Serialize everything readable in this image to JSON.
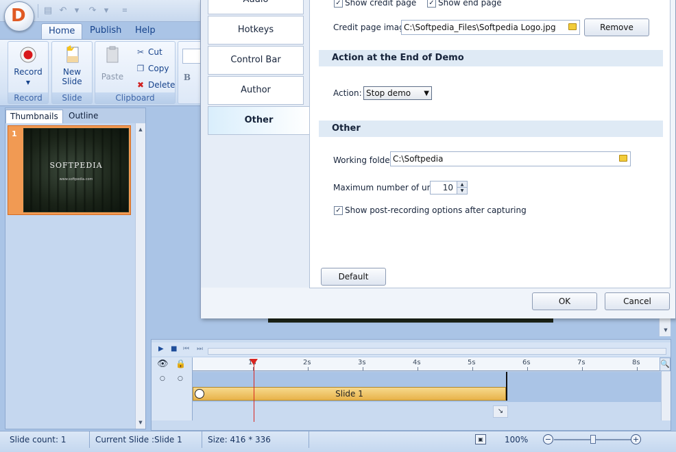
{
  "ribbon": {
    "tabs": [
      "Home",
      "Publish",
      "Help"
    ],
    "groups": {
      "record": {
        "label": "Record",
        "record_btn": "Record"
      },
      "slide": {
        "label": "Slide",
        "new_slide_line1": "New",
        "new_slide_line2": "Slide"
      },
      "clipboard": {
        "label": "Clipboard",
        "paste": "Paste",
        "cut": "Cut",
        "copy": "Copy",
        "delete": "Delete"
      }
    },
    "bold_glyph": "B"
  },
  "slides_pane": {
    "tabs": [
      "Thumbnails",
      "Outline"
    ],
    "thumbnail": {
      "number": "1",
      "logo_text": "SOFTPEDIA",
      "url_text": "www.softpedia.com"
    }
  },
  "dialog": {
    "nav": [
      "Audio",
      "Hotkeys",
      "Control Bar",
      "Author",
      "Other"
    ],
    "checkboxes": {
      "show_credit_page": {
        "label": "Show credit page",
        "checked": true
      },
      "show_end_page": {
        "label": "Show end page",
        "checked": true
      },
      "show_post_recording": {
        "label": "Show post-recording options after capturing",
        "checked": true
      }
    },
    "credit_page_image": {
      "label": "Credit page image:",
      "value": "C:\\Softpedia_Files\\Softpedia Logo.jpg",
      "remove_label": "Remove"
    },
    "section_action": {
      "title": "Action at the End of Demo",
      "action_label": "Action:",
      "action_value": "Stop demo"
    },
    "section_other": {
      "title": "Other",
      "working_folder_label": "Working folder:",
      "working_folder_value": "C:\\Softpedia",
      "max_undos_label": "Maximum number of undos:",
      "max_undos_value": "10"
    },
    "default_label": "Default",
    "ok_label": "OK",
    "cancel_label": "Cancel"
  },
  "timeline": {
    "ticks": [
      "1s",
      "2s",
      "3s",
      "4s",
      "5s",
      "6s",
      "7s",
      "8s"
    ],
    "slide_bar_label": "Slide 1"
  },
  "status_bar": {
    "slide_count": "Slide count: 1",
    "current_slide": "Current Slide :Slide 1",
    "size": "Size: 416 * 336",
    "zoom": "100%"
  },
  "colors": {
    "ribbon_text": "#15428b",
    "thumb_selected": "#f19a53",
    "slide_bar": "#e8b34a",
    "playhead": "#d9241f"
  }
}
